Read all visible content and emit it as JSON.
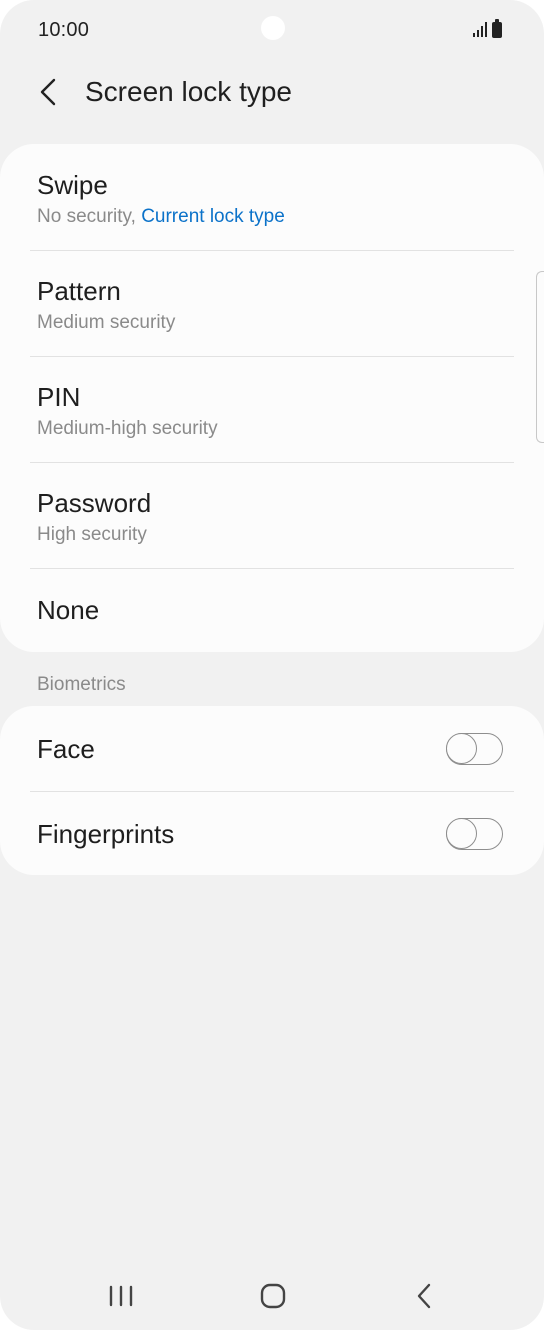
{
  "status_bar": {
    "time": "10:00"
  },
  "header": {
    "title": "Screen lock type"
  },
  "lock_types": [
    {
      "title": "Swipe",
      "subtitle": "No security, ",
      "subtitle_accent": "Current lock type"
    },
    {
      "title": "Pattern",
      "subtitle": "Medium security"
    },
    {
      "title": "PIN",
      "subtitle": "Medium-high security"
    },
    {
      "title": "Password",
      "subtitle": "High security"
    },
    {
      "title": "None"
    }
  ],
  "biometrics": {
    "header": "Biometrics",
    "items": [
      {
        "title": "Face",
        "enabled": false
      },
      {
        "title": "Fingerprints",
        "enabled": false
      }
    ]
  },
  "colors": {
    "accent": "#0b72c9",
    "background": "#f1f1f1",
    "card": "#fcfcfc"
  },
  "nav_icons": [
    "recents-icon",
    "home-icon",
    "back-icon"
  ]
}
